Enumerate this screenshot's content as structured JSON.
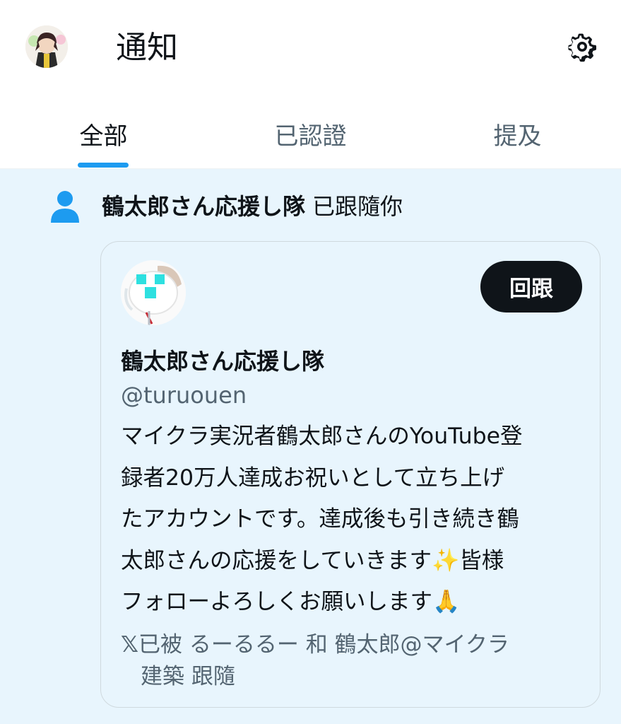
{
  "header": {
    "title": "通知",
    "settings_icon": "gear-icon"
  },
  "tabs": [
    {
      "label": "全部",
      "active": true
    },
    {
      "label": "已認證",
      "active": false
    },
    {
      "label": "提及",
      "active": false
    }
  ],
  "notification": {
    "icon": "person-icon",
    "actor_name": "鶴太郎さん応援し隊",
    "action_text": "已跟隨你",
    "card": {
      "follow_back_label": "回跟",
      "display_name": "鶴太郎さん応援し隊",
      "handle": "@turuouen",
      "bio_lines": [
        "マイクラ実況者鶴太郎さんのYouTube登",
        "録者20万人達成お祝いとして立ち上げ",
        "たアカウントです。達成後も引き続き鶴",
        "太郎さんの応援をしていきます✨皆様",
        "フォローよろしくお願いします🙏"
      ],
      "followed_by_icon": "𝕏",
      "followed_by_line1": "已被 るーるるー 和 鶴太郎@マイクラ",
      "followed_by_line2": "建築 跟隨"
    }
  },
  "colors": {
    "accent": "#1d9bf0",
    "notification_bg": "#e8f5fd",
    "primary_text": "#0f1419",
    "secondary_text": "#536471"
  }
}
